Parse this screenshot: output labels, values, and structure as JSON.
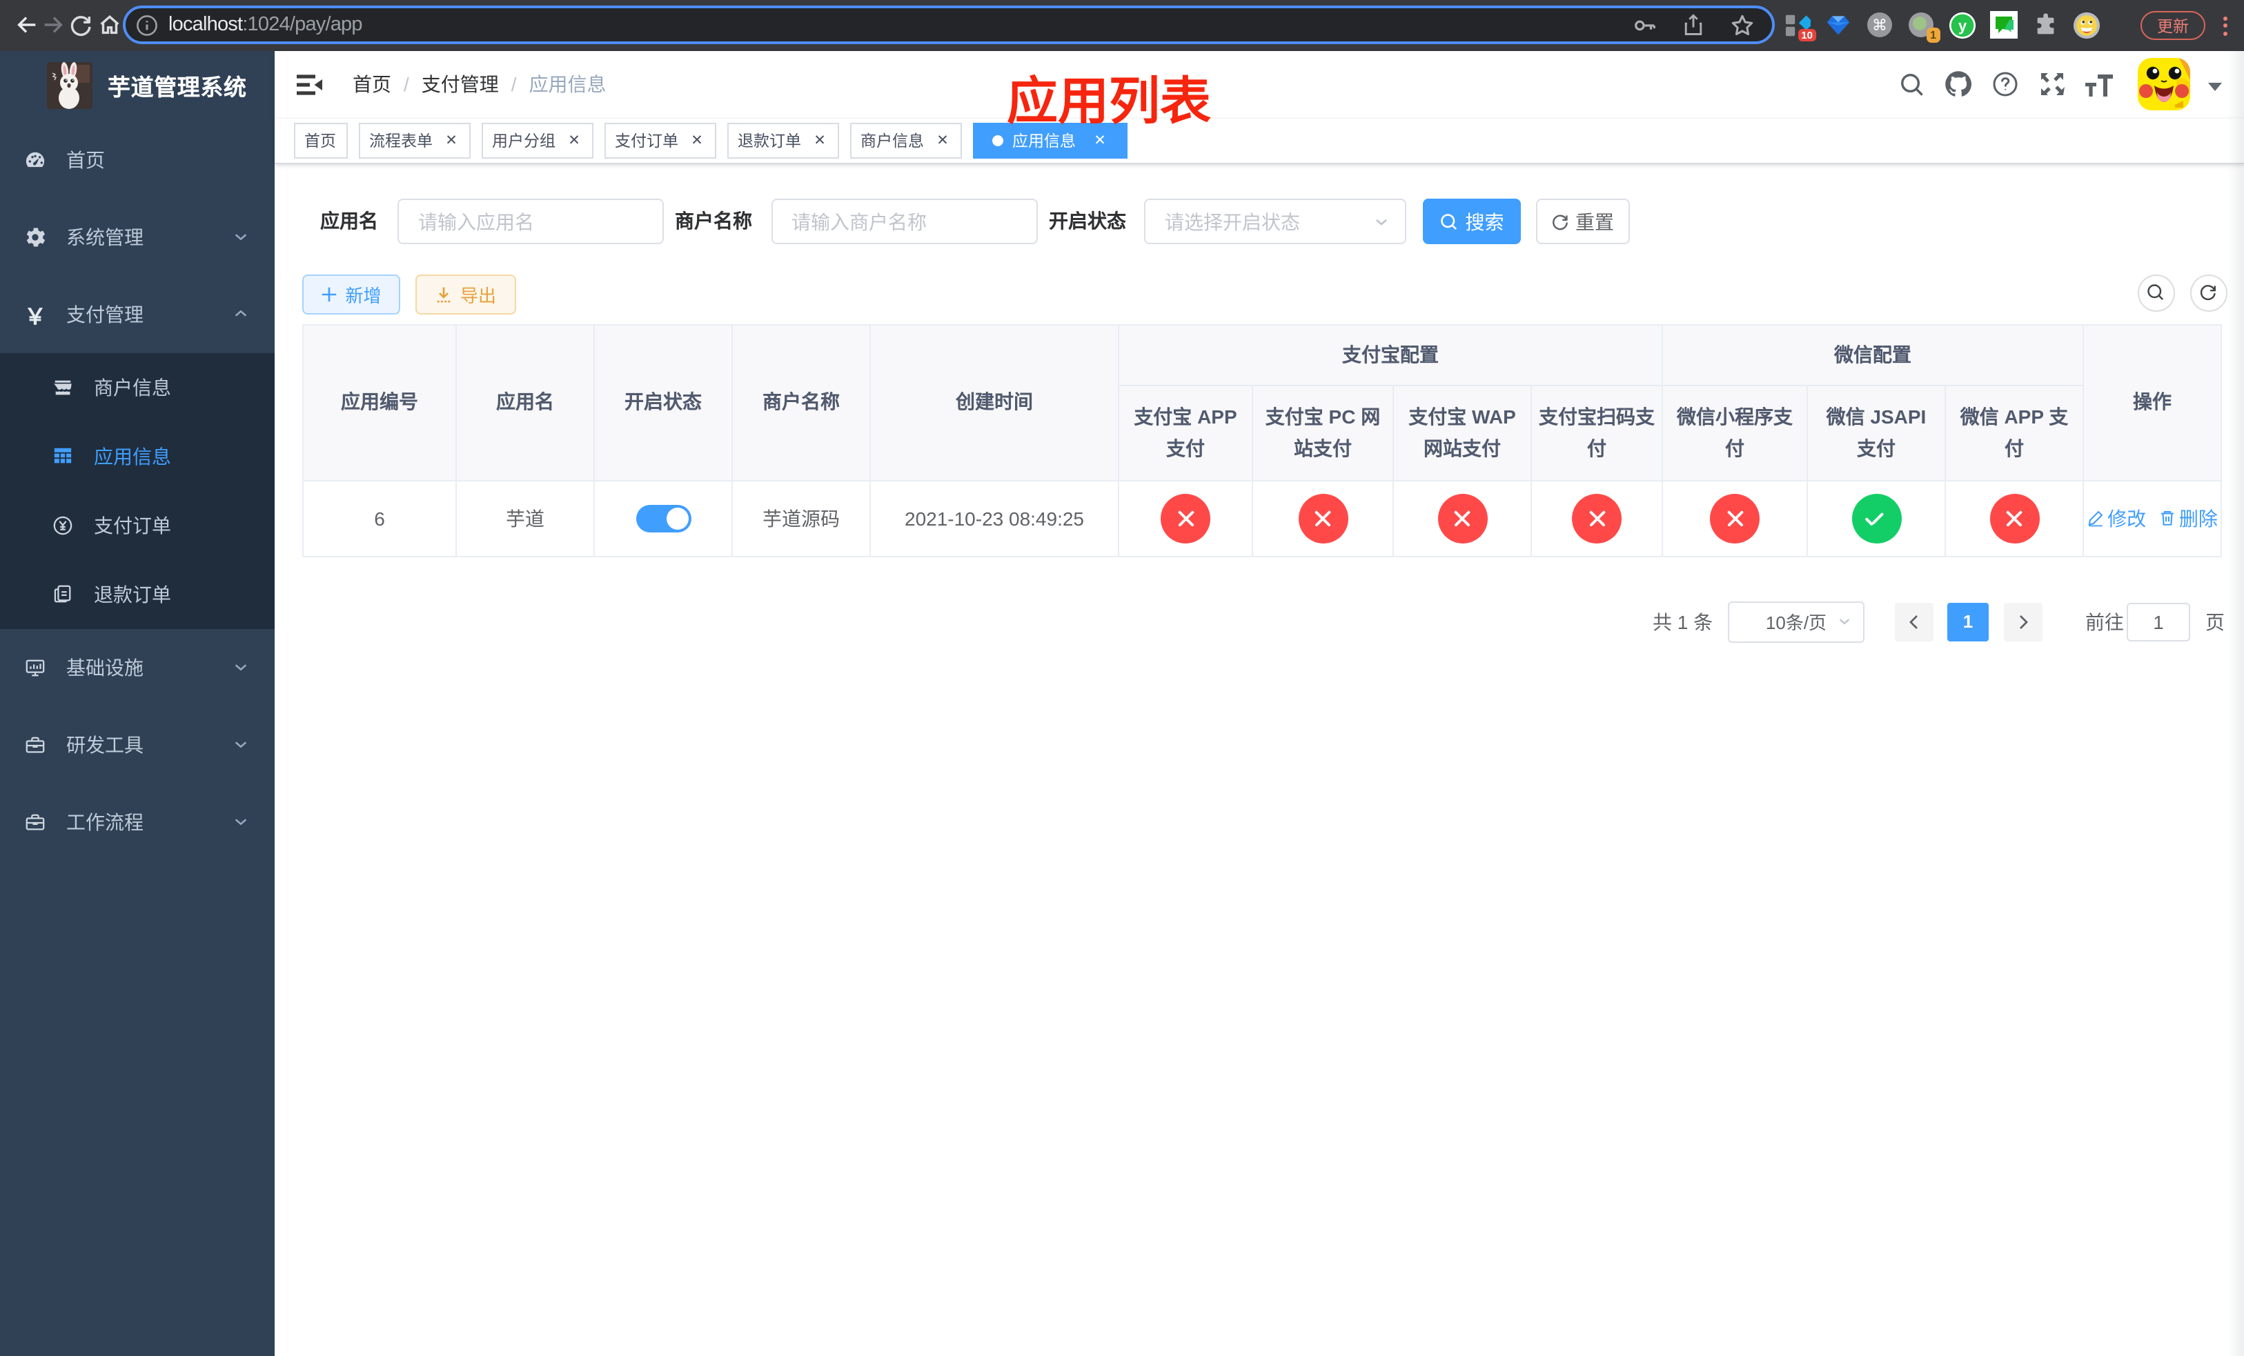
{
  "browser": {
    "url": {
      "host": "localhost",
      "path": ":1024/pay/app"
    },
    "update_label": "更新",
    "extensions": {
      "blocker_badge": "10",
      "proxy_badge": "1",
      "green_letter": "y"
    }
  },
  "sidebar": {
    "title": "芋道管理系统",
    "items": [
      {
        "label": "首页"
      },
      {
        "label": "系统管理"
      },
      {
        "label": "支付管理"
      },
      {
        "label": "商户信息"
      },
      {
        "label": "应用信息"
      },
      {
        "label": "支付订单"
      },
      {
        "label": "退款订单"
      },
      {
        "label": "基础设施"
      },
      {
        "label": "研发工具"
      },
      {
        "label": "工作流程"
      }
    ]
  },
  "navbar": {
    "breadcrumb": [
      "首页",
      "支付管理",
      "应用信息"
    ],
    "annotation": "应用列表"
  },
  "tags": [
    {
      "label": "首页"
    },
    {
      "label": "流程表单"
    },
    {
      "label": "用户分组"
    },
    {
      "label": "支付订单"
    },
    {
      "label": "退款订单"
    },
    {
      "label": "商户信息"
    },
    {
      "label": "应用信息"
    }
  ],
  "filter": {
    "app_name_label": "应用名",
    "app_name_placeholder": "请输入应用名",
    "merchant_label": "商户名称",
    "merchant_placeholder": "请输入商户名称",
    "status_label": "开启状态",
    "status_placeholder": "请选择开启状态",
    "search_label": "搜索",
    "reset_label": "重置"
  },
  "toolbar": {
    "add_label": "新增",
    "export_label": "导出"
  },
  "table": {
    "groups": {
      "alipay": "支付宝配置",
      "wechat": "微信配置"
    },
    "columns": [
      "应用编号",
      "应用名",
      "开启状态",
      "商户名称",
      "创建时间",
      "支付宝 APP 支付",
      "支付宝 PC 网站支付",
      "支付宝 WAP 网站支付",
      "支付宝扫码支付",
      "微信小程序支付",
      "微信 JSAPI 支付",
      "微信 APP 支付",
      "操作"
    ],
    "row": {
      "id": "6",
      "name": "芋道",
      "enabled": true,
      "merchant": "芋道源码",
      "created_at": "2021-10-23 08:49:25",
      "channels": [
        false,
        false,
        false,
        false,
        false,
        true,
        false
      ],
      "edit_label": "修改",
      "delete_label": "删除"
    }
  },
  "pagination": {
    "total": "共 1 条",
    "page_size": "10条/页",
    "current": "1",
    "goto_label": "前往",
    "goto_value": "1",
    "unit_label": "页"
  }
}
